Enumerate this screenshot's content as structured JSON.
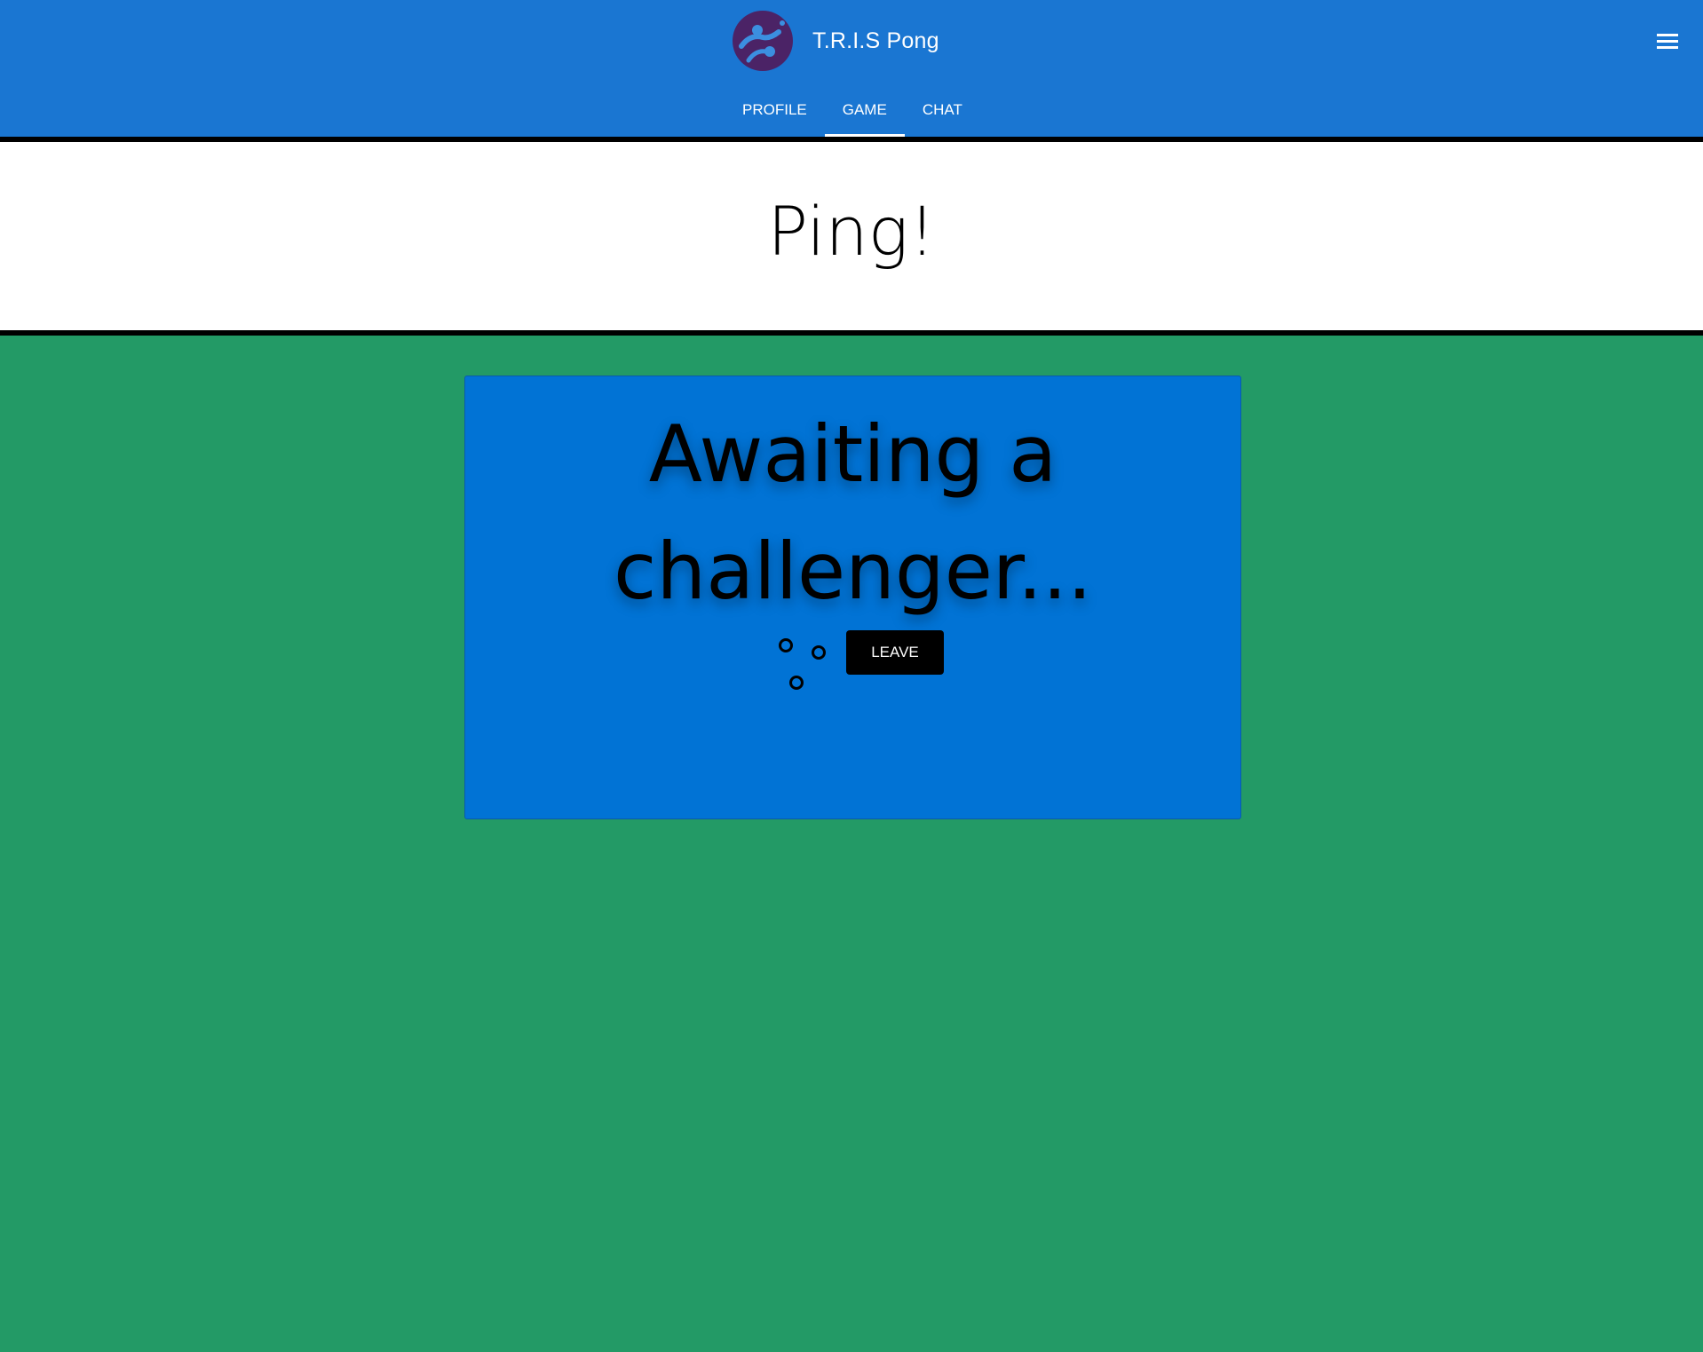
{
  "header": {
    "app_title": "T.R.I.S Pong",
    "logo_icon": "ping-pong-player-logo-icon",
    "menu_icon": "hamburger-menu-icon",
    "tabs": [
      {
        "label": "PROFILE",
        "active": false
      },
      {
        "label": "GAME",
        "active": true
      },
      {
        "label": "CHAT",
        "active": false
      }
    ],
    "colors": {
      "bar": "#1a76d2",
      "logo_bg": "#4b2366"
    }
  },
  "page": {
    "title": "Ping!",
    "background": "#239a66"
  },
  "game": {
    "status": "Awaiting a challenger...",
    "leave_label": "LEAVE",
    "spinner_icon": "loading-dots-icon",
    "card_color": "#0173d5"
  }
}
